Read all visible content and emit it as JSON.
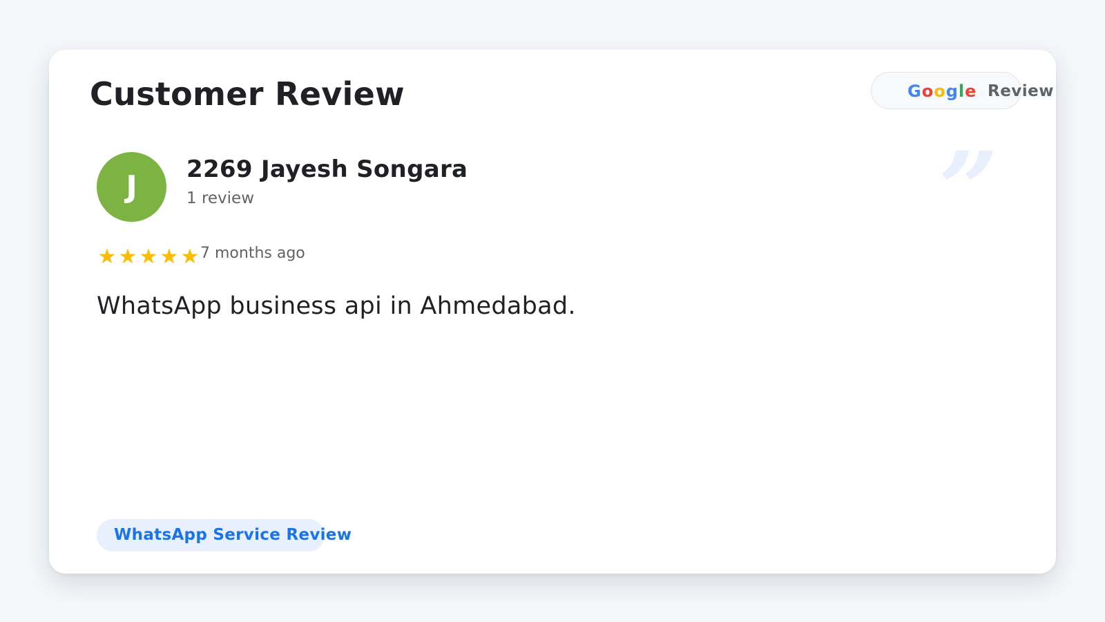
{
  "card": {
    "title": "Customer Review",
    "badge": {
      "google_letters": [
        {
          "char": "G",
          "color": "#4285f4"
        },
        {
          "char": "o",
          "color": "#ea4335"
        },
        {
          "char": "o",
          "color": "#fbbc05"
        },
        {
          "char": "g",
          "color": "#4285f4"
        },
        {
          "char": "l",
          "color": "#34a853"
        },
        {
          "char": "e",
          "color": "#ea4335"
        }
      ],
      "label": "Review"
    },
    "quote_glyph": "”",
    "reviewer": {
      "initial": "J",
      "avatar_color": "#7cb342",
      "name": "2269 Jayesh Songara",
      "review_count": "1 review"
    },
    "rating": {
      "stars": 5,
      "out_of": 5,
      "star_glyph": "★",
      "star_color": "#fbbc04"
    },
    "time_ago": "7 months ago",
    "review_text": "WhatsApp business api in Ahmedabad.",
    "tag": "WhatsApp Service Review"
  },
  "colors": {
    "background": "#f5f7fa",
    "card": "#ffffff",
    "primary_text": "#202124",
    "secondary_text": "#5f6368",
    "accent": "#1a73e8",
    "accent_soft": "#e8f0fe"
  },
  "icons": {
    "quote": "closing-quote-icon",
    "star": "star-icon"
  }
}
